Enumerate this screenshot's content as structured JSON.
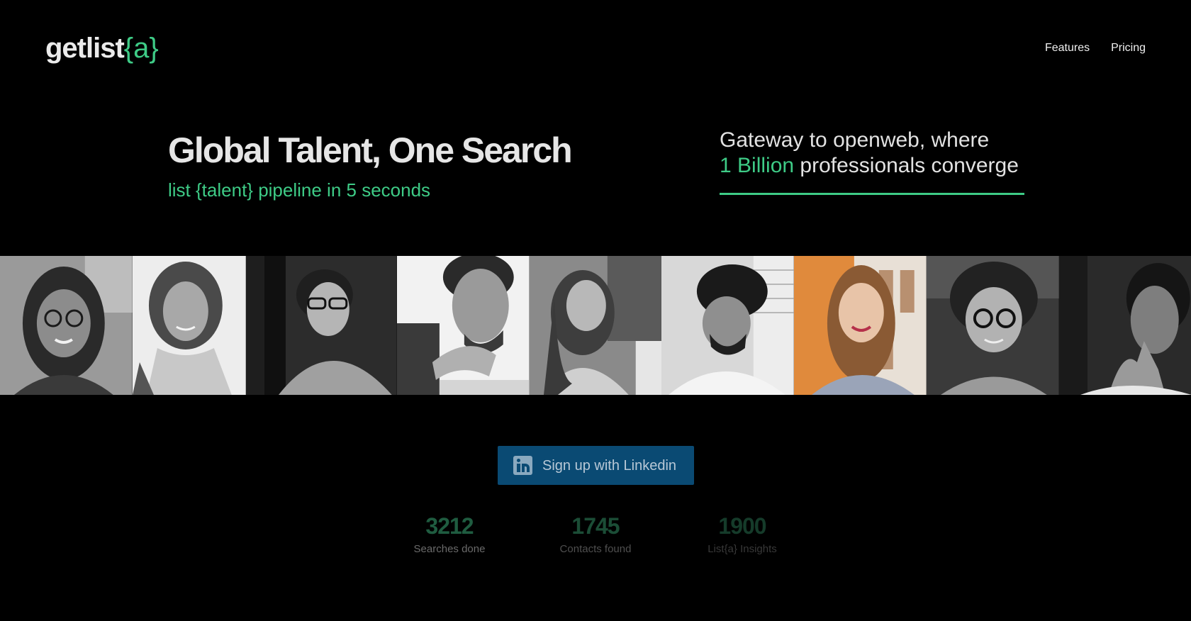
{
  "brand": {
    "name": "getlist",
    "accent": "{a}",
    "accent_color": "#3ecb86"
  },
  "nav": {
    "features_label": "Features",
    "pricing_label": "Pricing"
  },
  "hero": {
    "title": "Global Talent, One Search",
    "subtitle": "list {talent} pipeline in 5 seconds"
  },
  "gateway": {
    "line1": "Gateway to openweb, where",
    "highlight": "1 Billion",
    "line2_rest": " professionals converge"
  },
  "photos": [
    {
      "icon": "person-photo",
      "tone": "grayscale"
    },
    {
      "icon": "person-photo",
      "tone": "grayscale"
    },
    {
      "icon": "person-photo",
      "tone": "grayscale"
    },
    {
      "icon": "person-photo",
      "tone": "grayscale"
    },
    {
      "icon": "person-photo",
      "tone": "grayscale"
    },
    {
      "icon": "person-photo",
      "tone": "grayscale"
    },
    {
      "icon": "person-photo",
      "tone": "color"
    },
    {
      "icon": "person-photo",
      "tone": "grayscale"
    },
    {
      "icon": "person-photo",
      "tone": "grayscale"
    }
  ],
  "cta": {
    "label": "Sign up with Linkedin",
    "icon": "linkedin-icon",
    "color": "#0a4a73"
  },
  "stats": [
    {
      "value": "3212",
      "label": "Searches done"
    },
    {
      "value": "1745",
      "label": "Contacts found"
    },
    {
      "value": "1900",
      "label": "List{a} Insights"
    }
  ]
}
